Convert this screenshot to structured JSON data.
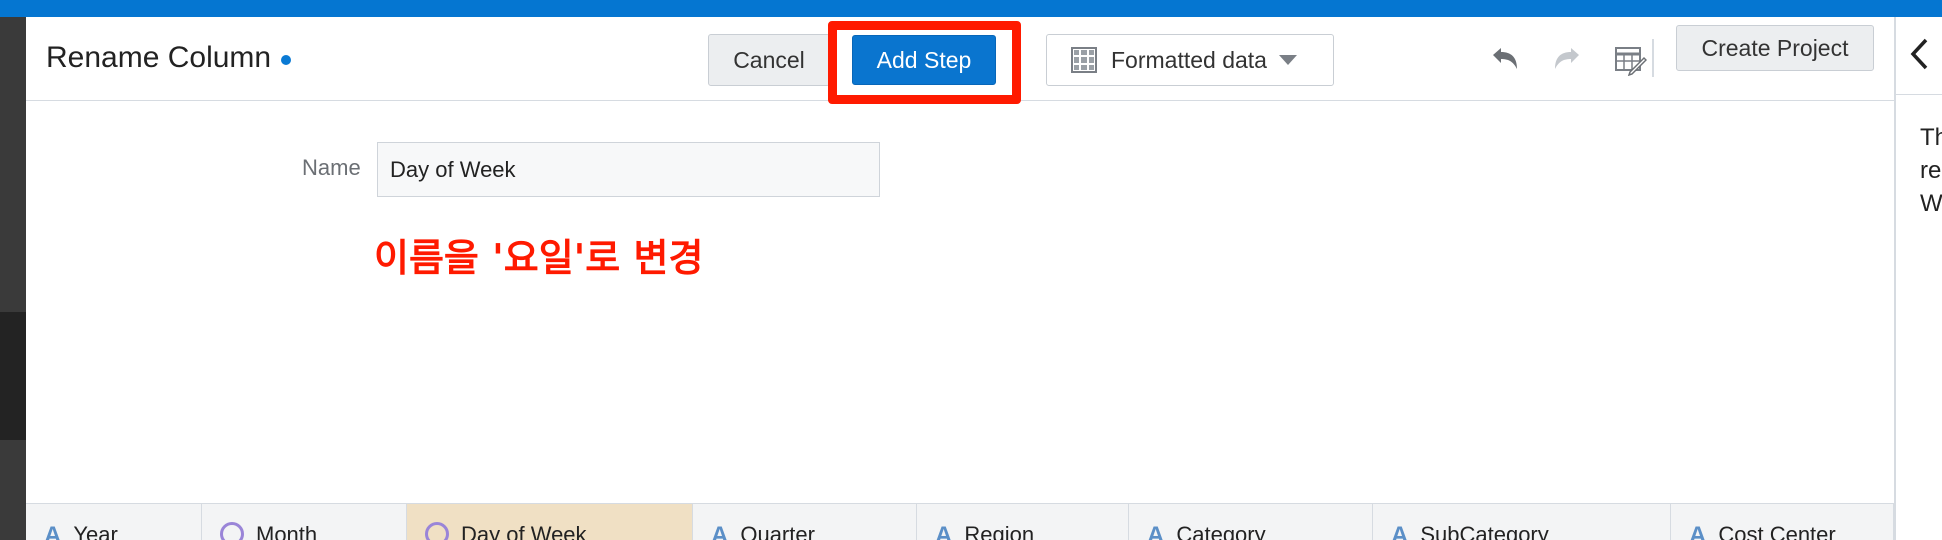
{
  "header": {
    "title": "Rename Column",
    "cancel_label": "Cancel",
    "add_step_label": "Add Step",
    "format_label": "Formatted data",
    "create_project_label": "Create Project"
  },
  "form": {
    "name_label": "Name",
    "name_value": "Day of Week"
  },
  "annotation": "이름을 '요일'로 변경",
  "right_panel": {
    "text_lines": [
      "Th",
      "re",
      "W"
    ]
  },
  "columns": [
    {
      "label": "Year",
      "type": "text"
    },
    {
      "label": "Month",
      "type": "time"
    },
    {
      "label": "Day of Week",
      "type": "time",
      "selected": true
    },
    {
      "label": "Quarter",
      "type": "text"
    },
    {
      "label": "Region",
      "type": "text"
    },
    {
      "label": "Category",
      "type": "text"
    },
    {
      "label": "SubCategory",
      "type": "text"
    },
    {
      "label": "Cost Center",
      "type": "text"
    }
  ],
  "icons": [
    "undo-icon",
    "redo-icon",
    "edit-table-icon",
    "grid-icon",
    "caret-down-icon",
    "chevron-left-icon",
    "text-type-icon",
    "clock-icon"
  ],
  "colors": {
    "accent": "#0a75cf",
    "highlight": "#ff1a00",
    "selected_column": "#f0e0c4"
  }
}
